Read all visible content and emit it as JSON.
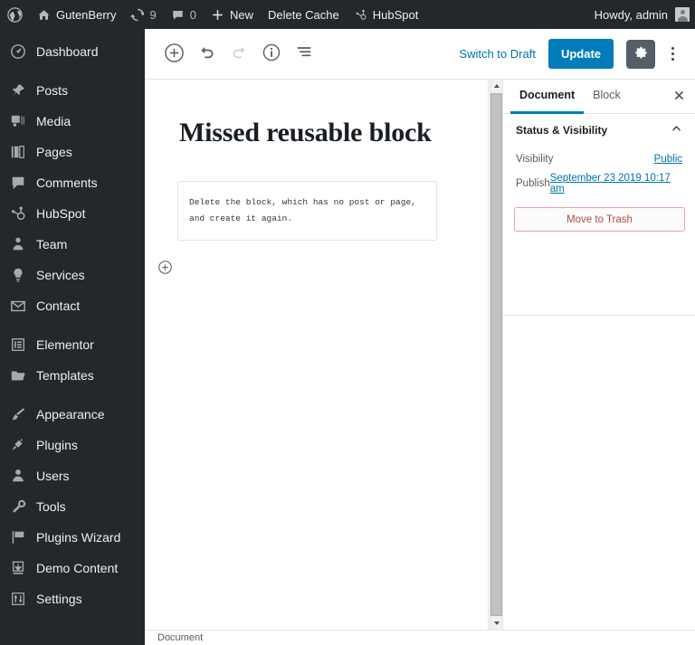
{
  "adminbar": {
    "logo_icon": "wordpress-logo-icon",
    "site": {
      "label": "GutenBerry",
      "icon": "home-icon"
    },
    "updates": {
      "count": "9",
      "icon": "updates-icon"
    },
    "comments": {
      "count": "0",
      "icon": "comment-bubble-icon"
    },
    "new": {
      "label": "New",
      "icon": "plus-icon"
    },
    "delete_cache": {
      "label": "Delete Cache"
    },
    "hubspot": {
      "label": "HubSpot",
      "icon": "hubspot-icon"
    },
    "howdy": {
      "label": "Howdy, admin",
      "avatar_icon": "avatar-icon"
    }
  },
  "sidebar": {
    "items": [
      {
        "label": "Dashboard",
        "icon": "dashboard-icon",
        "sep_after": true
      },
      {
        "label": "Posts",
        "icon": "pin-icon",
        "sep_after": false
      },
      {
        "label": "Media",
        "icon": "media-icon",
        "sep_after": false
      },
      {
        "label": "Pages",
        "icon": "pages-icon",
        "sep_after": false
      },
      {
        "label": "Comments",
        "icon": "comment-bubble-icon",
        "sep_after": false
      },
      {
        "label": "HubSpot",
        "icon": "hubspot-icon",
        "sep_after": false
      },
      {
        "label": "Team",
        "icon": "team-icon",
        "sep_after": false
      },
      {
        "label": "Services",
        "icon": "lightbulb-icon",
        "sep_after": false
      },
      {
        "label": "Contact",
        "icon": "envelope-icon",
        "sep_after": true
      },
      {
        "label": "Elementor",
        "icon": "elementor-icon",
        "sep_after": false
      },
      {
        "label": "Templates",
        "icon": "folder-icon",
        "sep_after": true
      },
      {
        "label": "Appearance",
        "icon": "paintbrush-icon",
        "sep_after": false
      },
      {
        "label": "Plugins",
        "icon": "plug-icon",
        "sep_after": false
      },
      {
        "label": "Users",
        "icon": "user-icon",
        "sep_after": false
      },
      {
        "label": "Tools",
        "icon": "wrench-icon",
        "sep_after": false
      },
      {
        "label": "Plugins Wizard",
        "icon": "flag-icon",
        "sep_after": false
      },
      {
        "label": "Demo Content",
        "icon": "download-icon",
        "sep_after": false
      },
      {
        "label": "Settings",
        "icon": "sliders-icon",
        "sep_after": false
      }
    ]
  },
  "toolbar": {
    "add_block_icon": "circle-plus-icon",
    "undo_icon": "undo-arrow-icon",
    "redo_icon": "redo-arrow-icon",
    "info_icon": "circle-info-icon",
    "list_view_icon": "list-view-icon",
    "switch_to_draft": "Switch to Draft",
    "update_label": "Update",
    "settings_icon": "gear-icon",
    "more_icon": "three-dots-vertical-icon"
  },
  "editor": {
    "title": "Missed reusable block",
    "block_text": "Delete the block, which has no post or page, and create it again.",
    "inserter_icon": "circle-plus-icon"
  },
  "panel": {
    "tabs": [
      {
        "label": "Document",
        "active": true
      },
      {
        "label": "Block",
        "active": false
      }
    ],
    "close_icon": "close-icon",
    "section_title": "Status & Visibility",
    "collapse_icon": "chevron-up-icon",
    "rows": [
      {
        "label": "Visibility",
        "value": "Public"
      },
      {
        "label": "Publish",
        "value": "September 23 2019 10:17 am"
      }
    ],
    "trash_label": "Move to Trash"
  },
  "footer": {
    "breadcrumb": "Document"
  },
  "colors": {
    "admin_dark": "#23282d",
    "accent_blue": "#007cba",
    "link_blue": "#0073aa",
    "trash_red": "#b34a4a",
    "gear_active": "#555d66"
  }
}
